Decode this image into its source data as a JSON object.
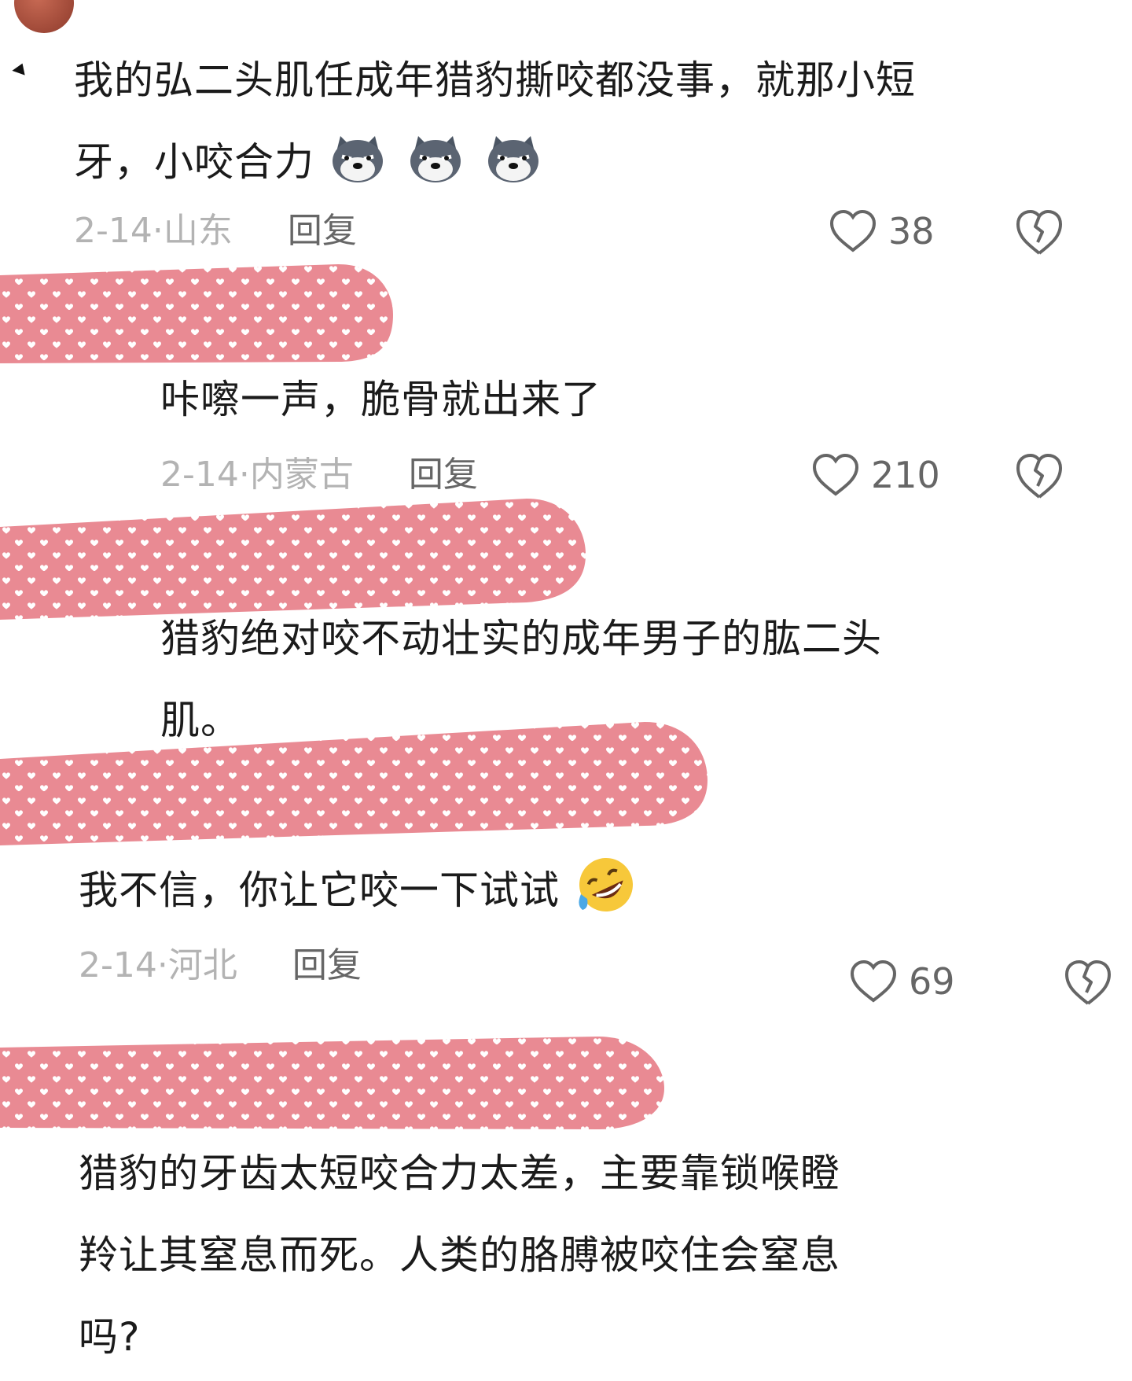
{
  "comments": [
    {
      "text_lines": [
        "我的弘二头肌任成年猎豹撕咬都没事，就那小短",
        "牙，小咬合力"
      ],
      "emoji": [
        "dog-face-emoji",
        "dog-face-emoji",
        "dog-face-emoji"
      ],
      "date": "2-14·",
      "location": "山东",
      "reply_label": "回复",
      "likes": "38"
    },
    {
      "text_lines": [
        "咔嚓一声，脆骨就出来了"
      ],
      "date": "2-14·",
      "location": "内蒙古",
      "reply_label": "回复",
      "likes": "210"
    },
    {
      "text_lines": [
        "猎豹绝对咬不动壮实的成年男子的肱二头",
        "肌。"
      ]
    },
    {
      "text_lines": [
        "我不信，你让它咬一下试试"
      ],
      "emoji": [
        "rolling-laughing-emoji"
      ],
      "date": "2-14·",
      "location": "河北",
      "reply_label": "回复",
      "likes": "69"
    },
    {
      "text_lines": [
        "猎豹的牙齿太短咬合力太差，主要靠锁喉瞪",
        "羚让其窒息而死。人类的胳膊被咬住会窒息",
        "吗?"
      ]
    }
  ],
  "colors": {
    "text": "#1b1b1b",
    "meta": "#b3b3b3",
    "action": "#666666",
    "redaction_pink": "#e98a93",
    "redaction_hearts": "#ffffff"
  }
}
